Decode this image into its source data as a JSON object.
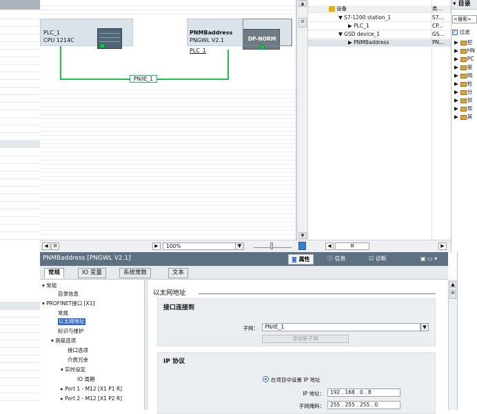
{
  "network": {
    "devices": [
      {
        "name": "PLC_1",
        "type": "CPU 1214C"
      },
      {
        "name": "PNMBaddress",
        "type": "PNGWL V2.1",
        "link": "PLC_1",
        "module_label": "DP-NORM"
      }
    ],
    "subnet_label": "PN/IE_1",
    "zoom": "100%"
  },
  "device_table": {
    "header": {
      "col1": "设备",
      "col2": "类..."
    },
    "rows": [
      {
        "name": "S7-1200 station_1",
        "type": "S7..."
      },
      {
        "name": "PLC_1",
        "type": "CP..."
      },
      {
        "name": "GSD device_1",
        "type": "GS..."
      },
      {
        "name": "PNMBaddress",
        "type": "PN..."
      }
    ]
  },
  "catalog": {
    "title": "目录",
    "search": "<搜索>",
    "filter": "过滤",
    "items": [
      "控",
      "HN",
      "PC",
      "驱",
      "网",
      "检",
      "分",
      "供",
      "现",
      "其"
    ]
  },
  "inspector": {
    "title": "PNMBaddress [PNGWL V2.1]",
    "top_tabs": {
      "properties": "属性",
      "info": "信息",
      "diagnostics": "诊断"
    },
    "tabs": [
      "常规",
      "IO 变量",
      "系统常数",
      "文本"
    ],
    "tree": [
      {
        "label": "常规"
      },
      {
        "label": "目录信息"
      },
      {
        "label": "PROFINET接口 [X1]"
      },
      {
        "label": "常规"
      },
      {
        "label": "以太网地址"
      },
      {
        "label": "标识与维护"
      },
      {
        "label": "高级选项"
      },
      {
        "label": "接口选项"
      },
      {
        "label": "介质冗余"
      },
      {
        "label": "实时设定"
      },
      {
        "label": "IO 周期"
      },
      {
        "label": "Port 1 - M12 [X1 P1 R]"
      },
      {
        "label": "Port 2 - M12 [X1 P2 R]"
      }
    ],
    "content": {
      "heading": "以太网地址",
      "sec_interface": {
        "title": "接口连接到",
        "subnet_label": "子网：",
        "subnet_value": "PN/IE_1",
        "add_button": "添加新子网"
      },
      "sec_ip": {
        "title": "IP 协议",
        "radio_label": "在项目中设置 IP 地址",
        "ip_label": "IP 地址：",
        "ip_value": "192 . 168 . 0    . 8",
        "mask_label": "子网掩码：",
        "mask_value": "255 . 255 . 255 . 0"
      }
    }
  }
}
